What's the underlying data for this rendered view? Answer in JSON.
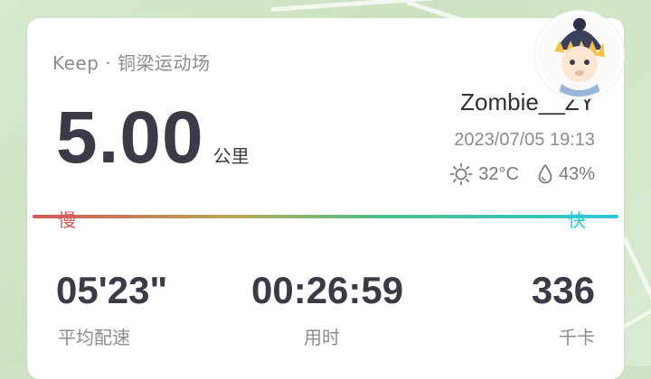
{
  "header": {
    "source": "Keep · 铜梁运动场"
  },
  "distance": {
    "value": "5.00",
    "unit": "公里"
  },
  "user": {
    "name": "Zombie__ZY",
    "datetime": "2023/07/05 19:13"
  },
  "weather": {
    "icon": "sun-icon",
    "temperature": "32°C",
    "humidity_icon": "droplet-icon",
    "humidity": "43%"
  },
  "speed_scale": {
    "slow_label": "慢",
    "fast_label": "快",
    "slow_color": "#d4585a",
    "fast_color": "#2ec7d8"
  },
  "stats": {
    "pace": {
      "value": "05'23\"",
      "label": "平均配速"
    },
    "duration": {
      "value": "00:26:59",
      "label": "用时"
    },
    "calories": {
      "value": "336",
      "label": "千卡"
    }
  },
  "colors": {
    "text_primary": "#3b3b47",
    "text_secondary": "#8c8c8c",
    "map_background": "#cfe3c6"
  }
}
